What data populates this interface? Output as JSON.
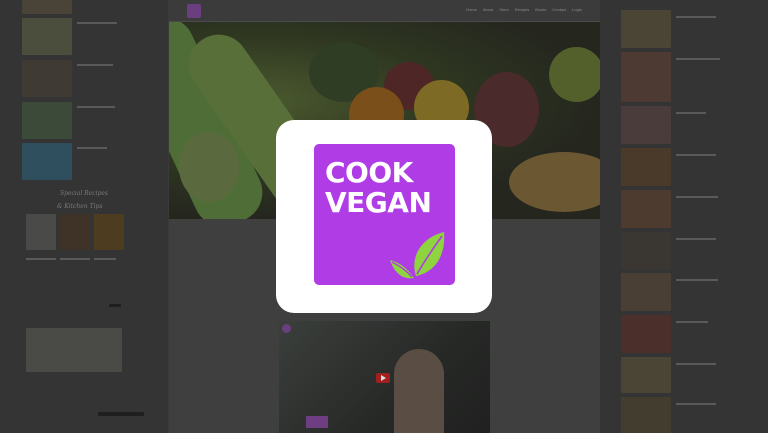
{
  "nav": {
    "links": [
      "Home",
      "About",
      "Store",
      "Recipes",
      "Books",
      "Contact",
      "Login"
    ]
  },
  "app_icon": {
    "line1": "COOK",
    "line2": "VEGAN",
    "background_color": "#b03ce6",
    "leaf_color": "#8ed43f",
    "icon": "leaf-icon"
  },
  "sidebar_left": {
    "section_line1": "Special Recipes",
    "section_line2": "& Kitchen Tips"
  },
  "video": {
    "icon": "play-icon"
  }
}
